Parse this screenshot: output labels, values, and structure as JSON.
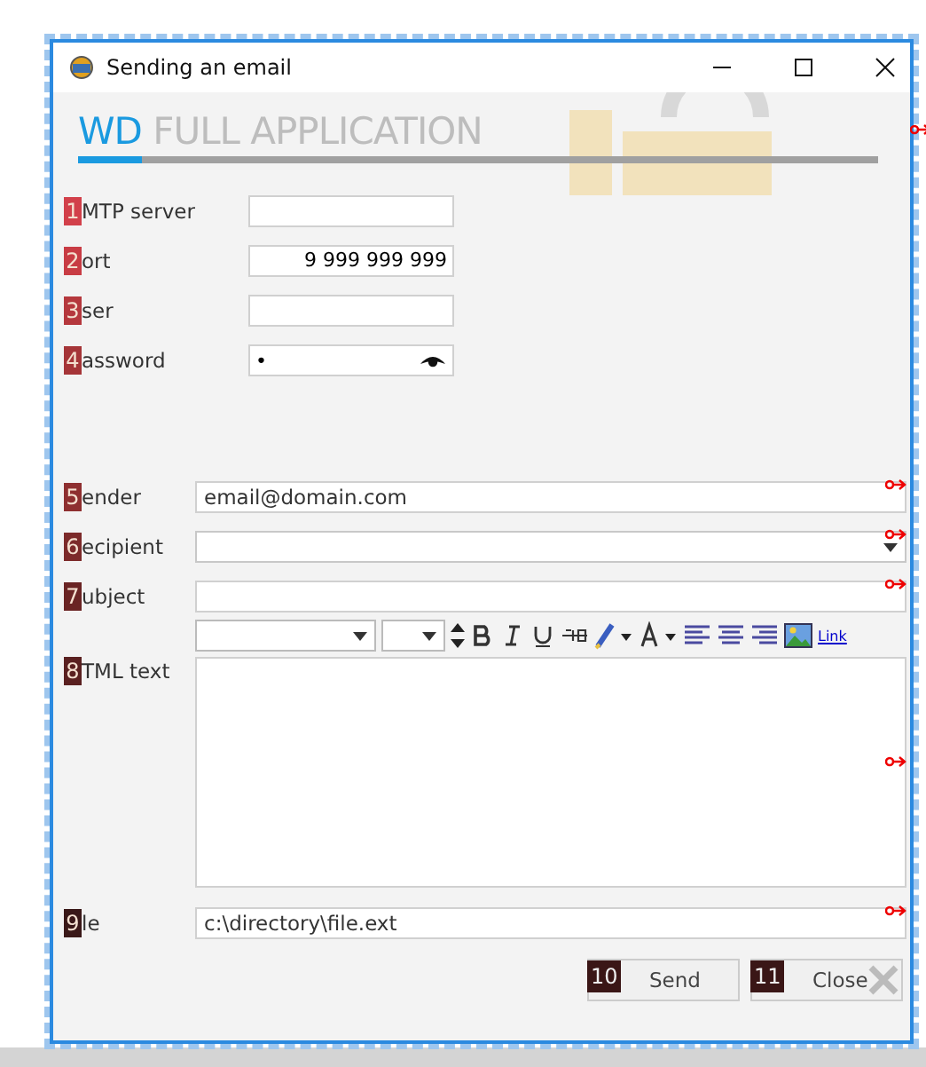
{
  "window": {
    "title": "Sending an email"
  },
  "banner": {
    "brand": "WD",
    "title": "FULL APPLICATION",
    "level": 0.08
  },
  "server_fields": [
    {
      "number": "1",
      "label": "MTP server",
      "kind": "text",
      "color": "#d2404a"
    },
    {
      "number": "2",
      "label": "ort",
      "value": "9 999 999 999",
      "kind": "number",
      "color": "#c83c44"
    },
    {
      "number": "3",
      "label": "ser",
      "kind": "text",
      "color": "#b5383d"
    },
    {
      "number": "4",
      "label": "assword",
      "value": "•",
      "kind": "password",
      "color": "#a53538"
    }
  ],
  "message_fields": [
    {
      "number": "5",
      "label": "ender",
      "value": "email@domain.com",
      "kind": "text",
      "color": "#8e2f30"
    },
    {
      "number": "6",
      "label": "ecipient",
      "kind": "combo",
      "color": "#7c2a2a"
    },
    {
      "number": "7",
      "label": "ubject",
      "kind": "text",
      "color": "#6a2424"
    }
  ],
  "toolbar": {
    "link": "Link"
  },
  "html_text": {
    "number": "8",
    "label": "TML text",
    "color": "#5a2020"
  },
  "file_field": {
    "number": "9",
    "label": "le",
    "value": "c:\\directory\\file.ext",
    "color": "#3a1818"
  },
  "buttons": [
    {
      "number": "10",
      "label": "Send",
      "kind": "send"
    },
    {
      "number": "11",
      "label": "Close",
      "kind": "close"
    }
  ]
}
